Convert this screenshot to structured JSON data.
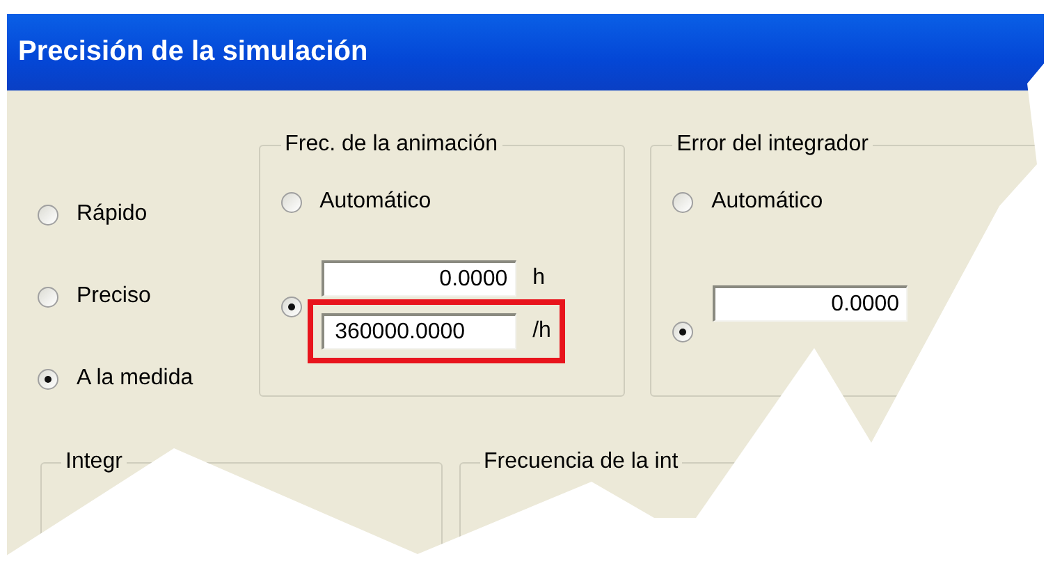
{
  "window": {
    "title": "Precisión de la simulación"
  },
  "precision_options": [
    {
      "label": "Rápido",
      "selected": false
    },
    {
      "label": "Preciso",
      "selected": false
    },
    {
      "label": "A la medida",
      "selected": true
    }
  ],
  "groups": [
    {
      "title": "Frec. de la animación",
      "options": [
        {
          "kind": "auto",
          "label": "Automático",
          "selected": false
        },
        {
          "kind": "values",
          "selected": true,
          "fields": [
            {
              "value": "0.0000",
              "unit": "h",
              "highlighted": false
            },
            {
              "value": "360000.0000",
              "unit": "/h",
              "highlighted": true
            }
          ]
        }
      ]
    },
    {
      "title": "Error del integrador",
      "options": [
        {
          "kind": "auto",
          "label": "Automático",
          "selected": false
        },
        {
          "kind": "values",
          "selected": true,
          "fields": [
            {
              "value": "0.0000",
              "highlighted": false
            }
          ]
        }
      ]
    }
  ],
  "bottom_groups": [
    {
      "title": "Integr"
    },
    {
      "title": "Frecuencia de la int"
    }
  ]
}
